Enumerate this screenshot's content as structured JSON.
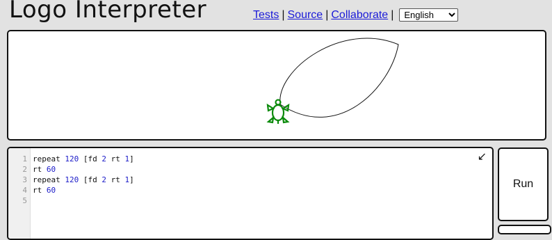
{
  "header": {
    "title": "Logo Interpreter",
    "links": {
      "tests": "Tests",
      "source": "Source",
      "collaborate": "Collaborate"
    },
    "separator": "|",
    "language": {
      "selected": "English"
    }
  },
  "editor": {
    "line_numbers": [
      "1",
      "2",
      "3",
      "4",
      "5"
    ],
    "lines": [
      {
        "cmd": "repeat ",
        "n1": "120",
        "mid": " [fd ",
        "n2": "2",
        "mid2": " rt ",
        "n3": "1",
        "end": "]"
      },
      {
        "cmd": "rt ",
        "n1": "60"
      },
      {
        "cmd": "repeat ",
        "n1": "120",
        "mid": " [fd ",
        "n2": "2",
        "mid2": " rt ",
        "n3": "1",
        "end": "]"
      },
      {
        "cmd": "rt ",
        "n1": "60"
      },
      {
        "cmd": ""
      }
    ],
    "expand_icon": "↙"
  },
  "run_label": "Run",
  "colors": {
    "turtle": "#0a8a0a",
    "number": "#1a1ac8",
    "link": "#1a1ad8"
  },
  "icons": {
    "turtle": "turtle-icon",
    "expand": "expand-icon",
    "dropdown": "chevron-down-icon"
  }
}
